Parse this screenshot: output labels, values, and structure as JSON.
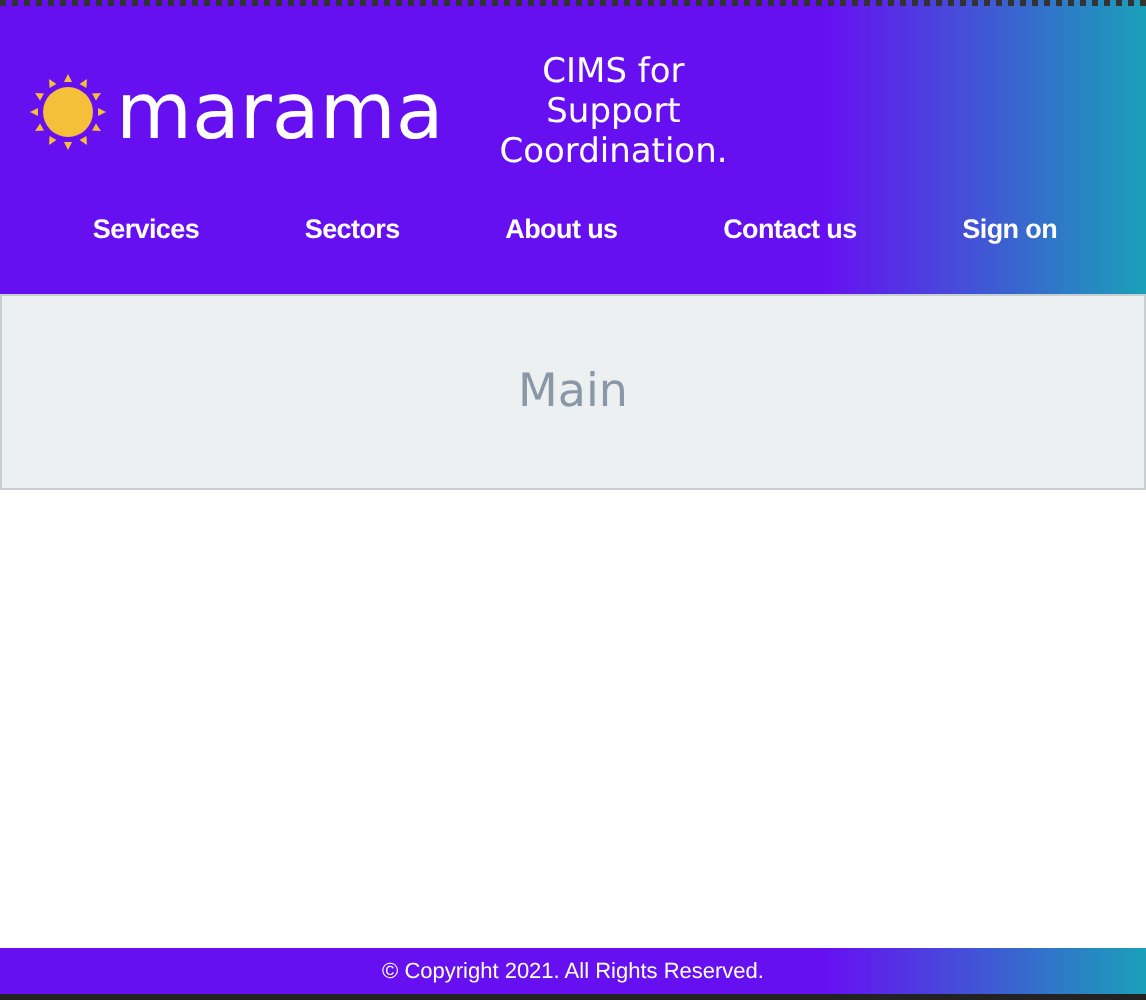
{
  "header": {
    "logo_text": "marama",
    "tagline": [
      "CIMS for",
      "Support",
      "Coordination."
    ]
  },
  "nav": [
    {
      "label": "Services"
    },
    {
      "label": "Sectors"
    },
    {
      "label": "About us"
    },
    {
      "label": "Contact us"
    },
    {
      "label": "Sign on"
    }
  ],
  "main": {
    "title": "Main"
  },
  "footer": {
    "text": "© Copyright 2021. All Rights Reserved."
  }
}
